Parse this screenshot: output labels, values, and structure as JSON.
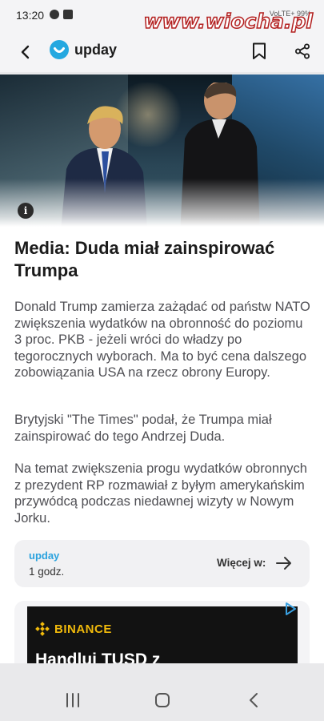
{
  "status_bar": {
    "time": "13:20",
    "network": "VoLTE+",
    "battery": "99%"
  },
  "watermark": "www.wiocha.pl",
  "app_bar": {
    "brand": "upday",
    "brand_color": "#24a8e0"
  },
  "article": {
    "headline": "Media: Duda miał zainspirować Trumpa",
    "paragraphs": [
      "Donald Trump zamierza zażądać od państw NATO zwiększenia wydatków na obronność do poziomu 3 proc. PKB - jeżeli wróci do władzy po tegorocznych wyborach. Ma to być cena dalszego zobowiązania USA na rzecz obrony Europy.",
      "Brytyjski \"The Times\" podał, że Trumpa miał zainspirować do tego Andrzej Duda.",
      "Na temat zwiększenia progu wydatków obronnych z prezydent RP rozmawiał z byłym amerykańskim przywódcą podczas niedawnej wizyty w Nowym Jorku."
    ]
  },
  "source_card": {
    "source": "upday",
    "time": "1 godz.",
    "more_label": "Więcej w:"
  },
  "ad": {
    "brand": "BINANCE",
    "brand_color": "#f0b90b",
    "headline": "Handluj TUSD z"
  },
  "icons": {
    "back": "back-arrow-icon",
    "bookmark": "bookmark-icon",
    "share": "share-icon",
    "info": "info-icon",
    "arrow": "arrow-right-icon",
    "ad_choices": "ad-choices-icon",
    "nav_recents": "recents-icon",
    "nav_home": "home-icon",
    "nav_back": "nav-back-icon"
  }
}
